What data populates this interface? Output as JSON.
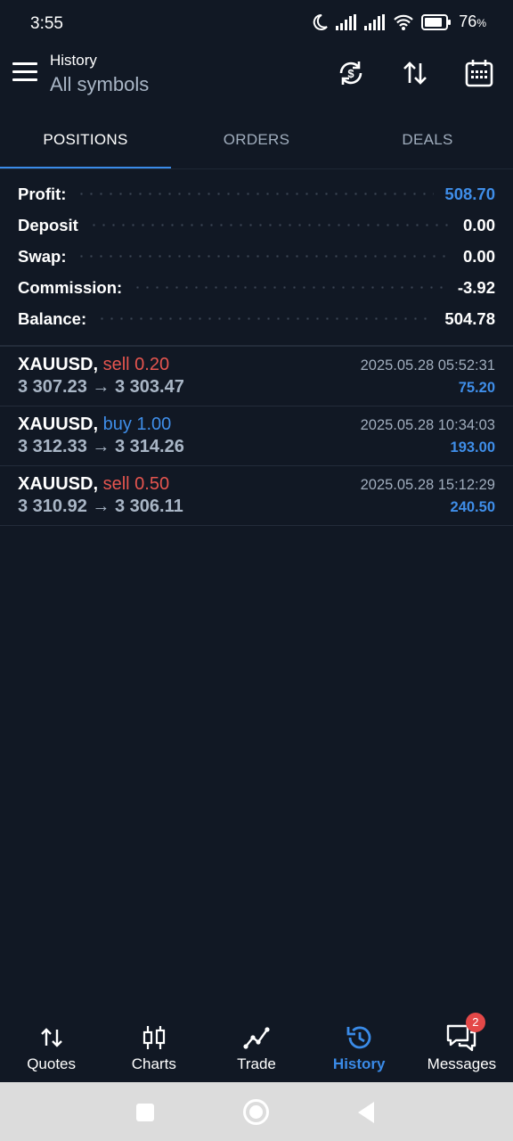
{
  "status_bar": {
    "time": "3:55",
    "battery_pct": "76",
    "battery_unit": "%"
  },
  "header": {
    "title": "History",
    "subtitle": "All symbols"
  },
  "tabs": [
    {
      "label": "POSITIONS",
      "active": true
    },
    {
      "label": "ORDERS",
      "active": false
    },
    {
      "label": "DEALS",
      "active": false
    }
  ],
  "summary": [
    {
      "label": "Profit:",
      "value": "508.70"
    },
    {
      "label": "Deposit",
      "value": "0.00"
    },
    {
      "label": "Swap:",
      "value": "0.00"
    },
    {
      "label": "Commission:",
      "value": "-3.92"
    },
    {
      "label": "Balance:",
      "value": "504.78"
    }
  ],
  "deals": [
    {
      "symbol": "XAUUSD,",
      "side": "sell 0.20",
      "prices": "3 307.23 → 3 303.47",
      "datetime": "2025.05.28 05:52:31",
      "profit": "75.20"
    },
    {
      "symbol": "XAUUSD,",
      "side": "buy 1.00",
      "prices": "3 312.33 → 3 314.26",
      "datetime": "2025.05.28 10:34:03",
      "profit": "193.00"
    },
    {
      "symbol": "XAUUSD,",
      "side": "sell 0.50",
      "prices": "3 310.92 → 3 306.11",
      "datetime": "2025.05.28 15:12:29",
      "profit": "240.50"
    }
  ],
  "bottom_nav": [
    {
      "label": "Quotes",
      "icon": "quotes-icon"
    },
    {
      "label": "Charts",
      "icon": "candlestick-icon"
    },
    {
      "label": "Trade",
      "icon": "trade-icon"
    },
    {
      "label": "History",
      "icon": "history-icon",
      "active": true
    },
    {
      "label": "Messages",
      "icon": "messages-icon",
      "badge": "2"
    }
  ],
  "colors": {
    "background": "#111824",
    "accent": "#3a8be8",
    "sell": "#e6554f",
    "buy": "#3f8ee9",
    "muted": "#a9b6c6"
  }
}
